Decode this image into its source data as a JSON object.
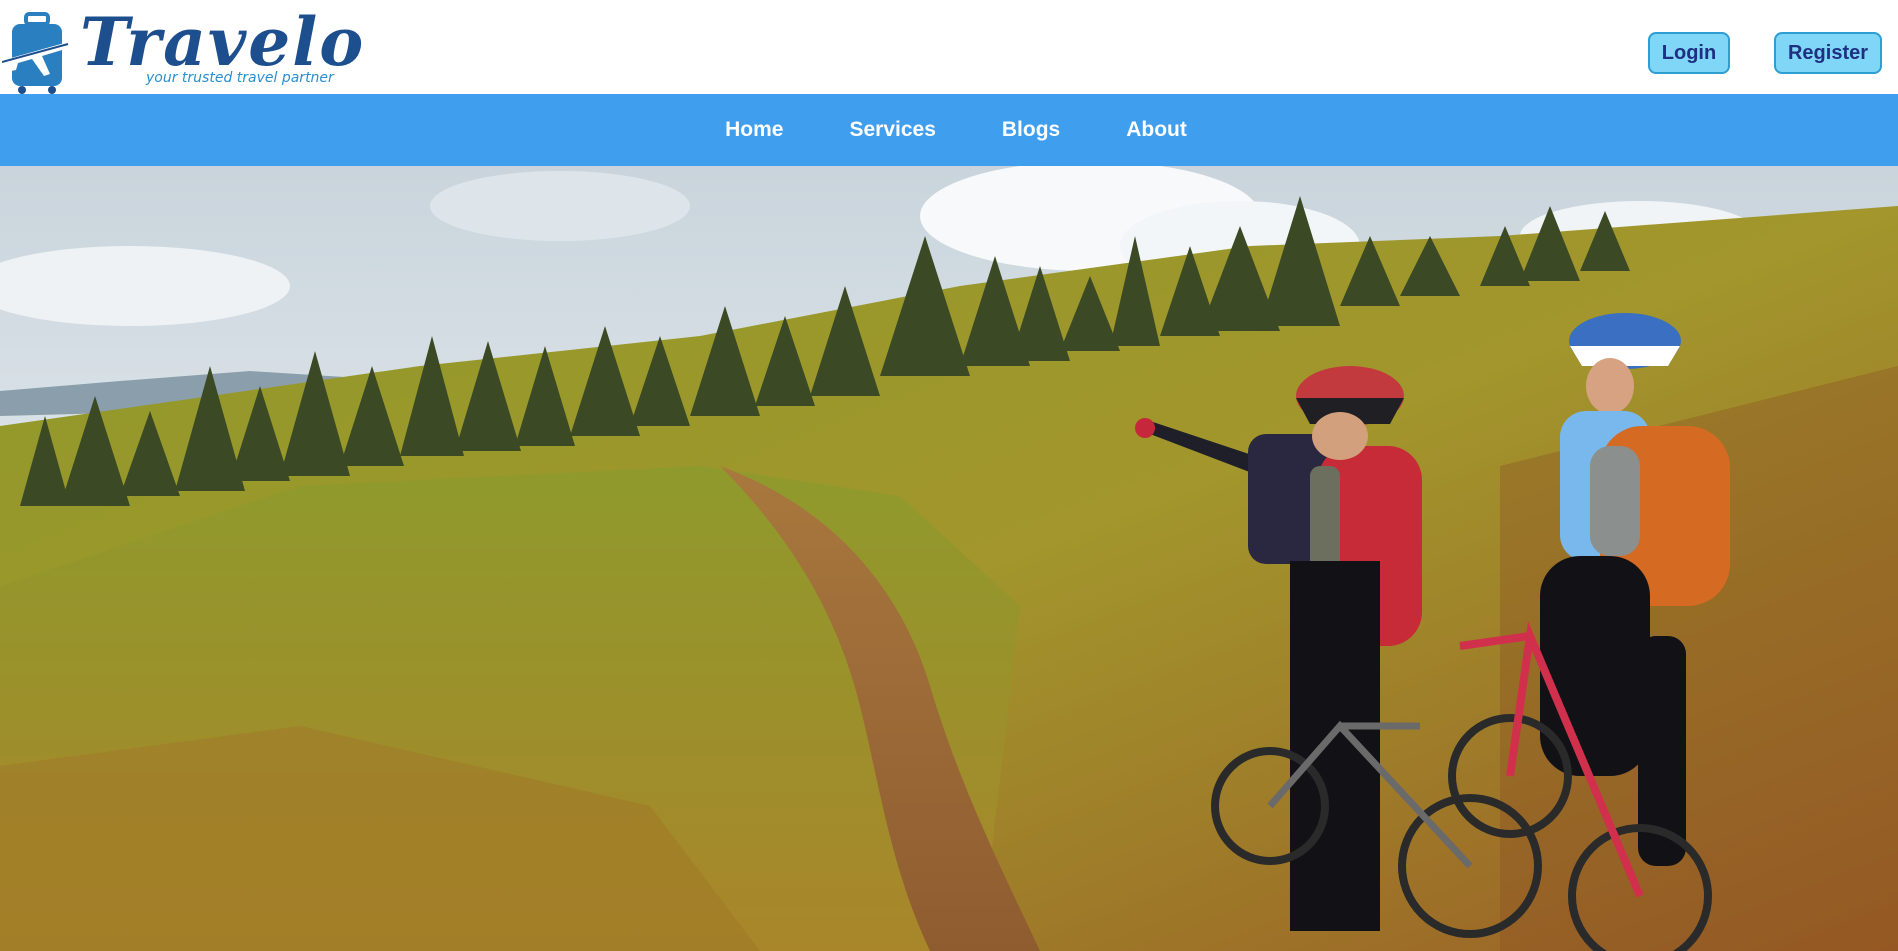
{
  "brand": {
    "name": "Travelo",
    "tagline": "your trusted travel partner",
    "colors": {
      "primary": "#1d4f8f",
      "accent": "#2a8fd0"
    }
  },
  "header": {
    "login_label": "Login",
    "register_label": "Register",
    "button_bg": "#7fd6f6",
    "button_text": "#1f2f82"
  },
  "nav": {
    "bg": "#409eee",
    "items": [
      {
        "label": "Home"
      },
      {
        "label": "Services"
      },
      {
        "label": "Blogs"
      },
      {
        "label": "About"
      }
    ]
  },
  "hero": {
    "icon": "mountain-bikers-photo"
  }
}
